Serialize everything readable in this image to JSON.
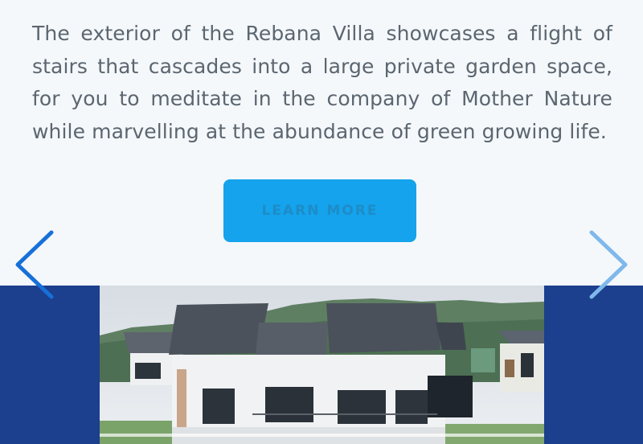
{
  "content": {
    "description": "The exterior of the Rebana Villa showcases a flight of stairs that cascades into a large private garden space, for you to meditate in the company of Mother Nature while marvelling at the abundance of green growing life.",
    "cta_label": "LEARN MORE"
  },
  "carousel": {
    "prev_icon": "chevron-left-icon",
    "next_icon": "chevron-right-icon",
    "photo_subject": "Rebana Villa exterior"
  },
  "colors": {
    "page_background": "#f4f8fb",
    "body_text": "#5c6670",
    "cta_background": "#14a3ec",
    "band_background": "#1c3f8e",
    "prev_arrow": "#1670d8",
    "next_arrow": "#7fb8ea"
  }
}
